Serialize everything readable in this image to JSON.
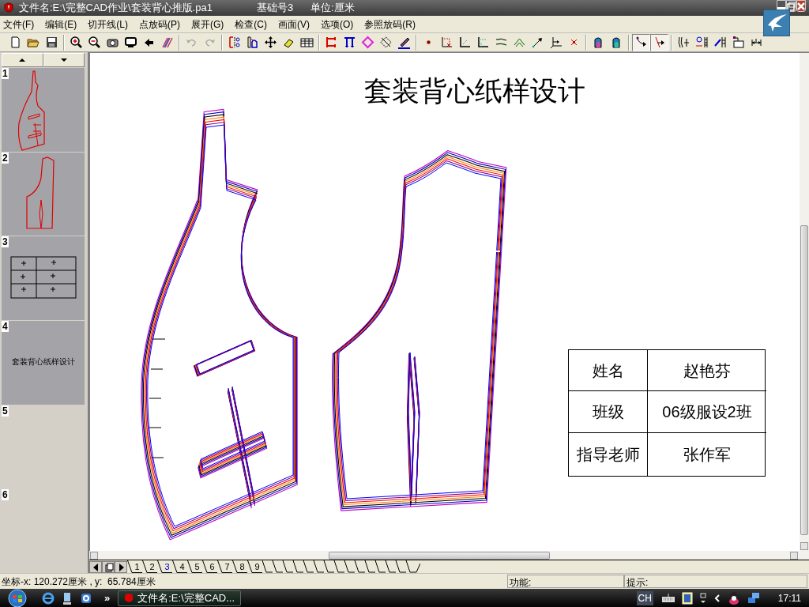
{
  "window": {
    "file": "文件名:E:\\完整CAD作业\\套装背心推版.pa1",
    "base_size": "基础号3",
    "unit": "单位:厘米"
  },
  "menu": [
    "文件(F)",
    "编辑(E)",
    "切开线(L)",
    "点放码(P)",
    "展开(G)",
    "检查(C)",
    "画面(V)",
    "选项(O)",
    "参照放码(R)"
  ],
  "toolbar": {
    "toggles": [
      {
        "pressed": true
      },
      {
        "pressed": true
      }
    ]
  },
  "thumbnails": [
    {
      "number": "1",
      "kind": "front"
    },
    {
      "number": "2",
      "kind": "back"
    },
    {
      "number": "3",
      "kind": "table"
    },
    {
      "number": "4",
      "kind": "text",
      "text": "套装背心纸样设计"
    },
    {
      "number": "5",
      "kind": "empty"
    },
    {
      "number": "6",
      "kind": "empty"
    }
  ],
  "canvas": {
    "title": "套装背心纸样设计",
    "info_table": [
      {
        "label": "姓名",
        "value": "赵艳芬"
      },
      {
        "label": "班级",
        "value": "06级服设2班"
      },
      {
        "label": "指导老师",
        "value": "张作军"
      }
    ]
  },
  "size_tabs": [
    {
      "label": "1",
      "selected": false
    },
    {
      "label": "2",
      "selected": false
    },
    {
      "label": "3",
      "selected": true
    },
    {
      "label": "4",
      "selected": false
    },
    {
      "label": "5",
      "selected": false
    },
    {
      "label": "6",
      "selected": false
    },
    {
      "label": "7",
      "selected": false
    },
    {
      "label": "8",
      "selected": false
    },
    {
      "label": "9",
      "selected": false
    }
  ],
  "status_bar": {
    "coordinates": "坐标-x: 120.272厘米 , y:  65.784厘米",
    "function": "功能:",
    "hint": "提示:"
  },
  "taskbar": {
    "more": "»",
    "task": "文件名:E:\\完整CAD...",
    "language": "CH",
    "clock": "17:11"
  }
}
